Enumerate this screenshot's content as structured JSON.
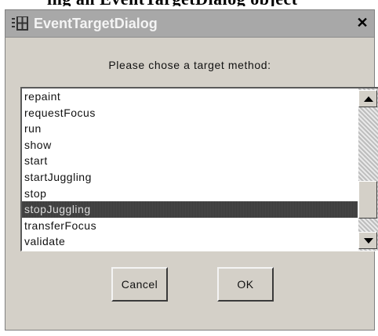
{
  "heading_fragment": "ing an EventTargetDialog object",
  "window": {
    "title": "EventTargetDialog",
    "close_label": "✕"
  },
  "prompt": "Please chose a target method:",
  "list": {
    "items": [
      {
        "label": "repaint",
        "selected": false
      },
      {
        "label": "requestFocus",
        "selected": false
      },
      {
        "label": "run",
        "selected": false
      },
      {
        "label": "show",
        "selected": false
      },
      {
        "label": "start",
        "selected": false
      },
      {
        "label": "startJuggling",
        "selected": false
      },
      {
        "label": "stop",
        "selected": false
      },
      {
        "label": "stopJuggling",
        "selected": true
      },
      {
        "label": "transferFocus",
        "selected": false
      },
      {
        "label": "validate",
        "selected": false
      }
    ],
    "scroll_position": 0.85
  },
  "buttons": {
    "cancel_label": "Cancel",
    "ok_label": "OK"
  }
}
